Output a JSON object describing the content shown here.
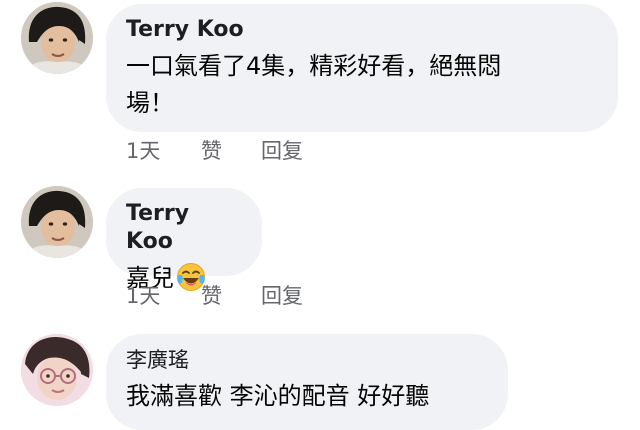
{
  "comments": [
    {
      "author": "Terry Koo",
      "text_lines": [
        "一口氣看了4集，精彩好看，絕無悶",
        "場！"
      ],
      "time": "1天",
      "like_label": "赞",
      "reply_label": "回复",
      "avatar_icon": "user-avatar-man-long-hair"
    },
    {
      "author": "Terry Koo",
      "text": "嘉兒",
      "emoji": "tears-of-joy-emoji",
      "time": "1天",
      "like_label": "赞",
      "reply_label": "回复",
      "avatar_icon": "user-avatar-man-long-hair"
    },
    {
      "author": "李廣瑤",
      "text": "我滿喜歡 李沁的配音 好好聽",
      "avatar_icon": "user-avatar-woman-glasses"
    }
  ],
  "colors": {
    "bubble": "#f0f2f5",
    "author": "#1c1e21",
    "text": "#050505",
    "meta": "#65676b"
  }
}
